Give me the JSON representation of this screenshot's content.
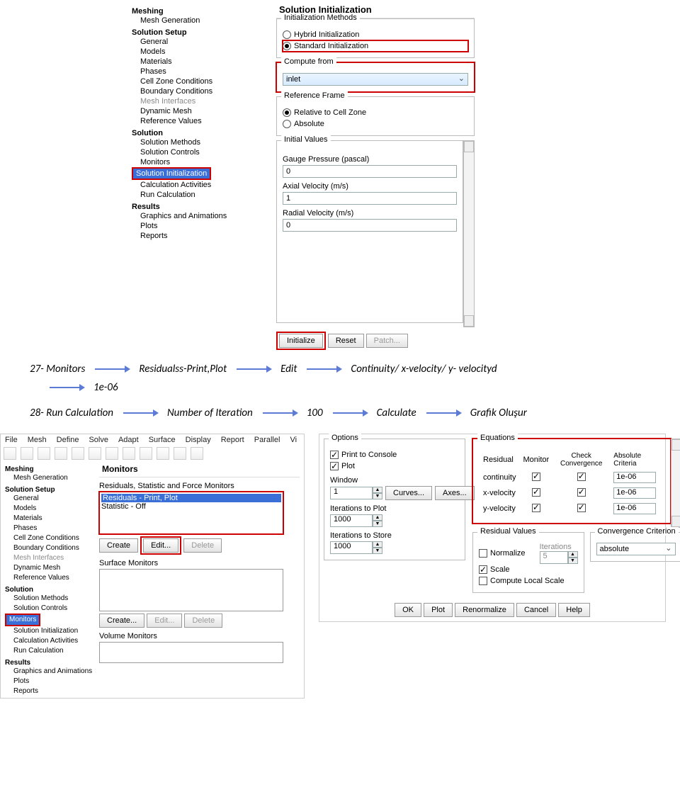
{
  "top_screenshot": {
    "tree": {
      "meshing": {
        "heading": "Meshing",
        "item": "Mesh Generation"
      },
      "setup": {
        "heading": "Solution Setup",
        "items": [
          "General",
          "Models",
          "Materials",
          "Phases",
          "Cell Zone Conditions",
          "Boundary Conditions",
          "Mesh Interfaces",
          "Dynamic Mesh",
          "Reference Values"
        ],
        "dim_index": 6
      },
      "solution": {
        "heading": "Solution",
        "items": [
          "Solution Methods",
          "Solution Controls",
          "Monitors",
          "Solution Initialization",
          "Calculation Activities",
          "Run Calculation"
        ],
        "selected": "Solution Initialization"
      },
      "results": {
        "heading": "Results",
        "items": [
          "Graphics and Animations",
          "Plots",
          "Reports"
        ]
      }
    },
    "panel": {
      "title": "Solution Initialization",
      "init_methods": {
        "legend": "Initialization Methods",
        "hybrid": "Hybrid  Initialization",
        "standard": "Standard Initialization"
      },
      "compute_from": {
        "legend": "Compute from",
        "value": "inlet"
      },
      "reference_frame": {
        "legend": "Reference Frame",
        "relative": "Relative to Cell Zone",
        "absolute": "Absolute"
      },
      "initial_values": {
        "legend": "Initial Values",
        "gauge_label": "Gauge Pressure (pascal)",
        "gauge_val": "0",
        "axial_label": "Axial Velocity (m/s)",
        "axial_val": "1",
        "radial_label": "Radial Velocity (m/s)",
        "radial_val": "0"
      },
      "buttons": {
        "initialize": "Initialize",
        "reset": "Reset",
        "patch": "Patch..."
      }
    }
  },
  "flow1": {
    "pre": "27- Monitors",
    "a": "Residualss-Print,Plot",
    "b": "Edit",
    "c": "Continuity/  x-velocity/  y- velocityd",
    "d": "1e-06"
  },
  "flow2": {
    "pre": "28- Run Calculation",
    "a": "Number of Iteration",
    "b": "100",
    "c": "Calculate",
    "d": "Grafik Oluşur"
  },
  "bottom_left": {
    "menubar": [
      "File",
      "Mesh",
      "Define",
      "Solve",
      "Adapt",
      "Surface",
      "Display",
      "Report",
      "Parallel",
      "Vi"
    ],
    "tree": {
      "meshing": {
        "heading": "Meshing",
        "item": "Mesh Generation"
      },
      "setup": {
        "heading": "Solution Setup",
        "items": [
          "General",
          "Models",
          "Materials",
          "Phases",
          "Cell Zone Conditions",
          "Boundary Conditions",
          "Mesh Interfaces",
          "Dynamic Mesh",
          "Reference Values"
        ]
      },
      "solution": {
        "heading": "Solution",
        "items": [
          "Solution Methods",
          "Solution Controls",
          "Monitors",
          "Solution Initialization",
          "Calculation Activities",
          "Run Calculation"
        ],
        "selected": "Monitors"
      },
      "results": {
        "heading": "Results",
        "items": [
          "Graphics and Animations",
          "Plots",
          "Reports"
        ]
      }
    },
    "panel": {
      "title": "Monitors",
      "rs_legend": "Residuals, Statistic and Force Monitors",
      "rs_sel": "Residuals - Print, Plot",
      "rs_other": "Statistic - Off",
      "rs_create": "Create",
      "rs_edit": "Edit...",
      "rs_delete": "Delete",
      "surf_legend": "Surface Monitors",
      "surf_create": "Create...",
      "surf_edit": "Edit...",
      "surf_delete": "Delete",
      "vol_legend": "Volume Monitors"
    }
  },
  "bottom_right": {
    "options": {
      "legend": "Options",
      "print": "Print to Console",
      "plot": "Plot",
      "window_label": "Window",
      "window_val": "1",
      "curves_btn": "Curves...",
      "axes_btn": "Axes...",
      "iter_plot_label": "Iterations to Plot",
      "iter_plot_val": "1000",
      "iter_store_label": "Iterations to Store",
      "iter_store_val": "1000"
    },
    "equations": {
      "legend": "Equations",
      "head_residual": "Residual",
      "head_monitor": "Monitor",
      "head_check": "Check Convergence",
      "head_abs": "Absolute Criteria",
      "rows": [
        {
          "name": "continuity",
          "val": "1e-06"
        },
        {
          "name": "x-velocity",
          "val": "1e-06"
        },
        {
          "name": "y-velocity",
          "val": "1e-06"
        }
      ]
    },
    "residual_values": {
      "legend": "Residual Values",
      "normalize": "Normalize",
      "iterations_label": "Iterations",
      "iterations_val": "5",
      "scale": "Scale",
      "compute_local": "Compute Local Scale"
    },
    "convergence": {
      "legend": "Convergence Criterion",
      "value": "absolute"
    },
    "buttons": {
      "ok": "OK",
      "plot": "Plot",
      "renorm": "Renormalize",
      "cancel": "Cancel",
      "help": "Help"
    }
  }
}
